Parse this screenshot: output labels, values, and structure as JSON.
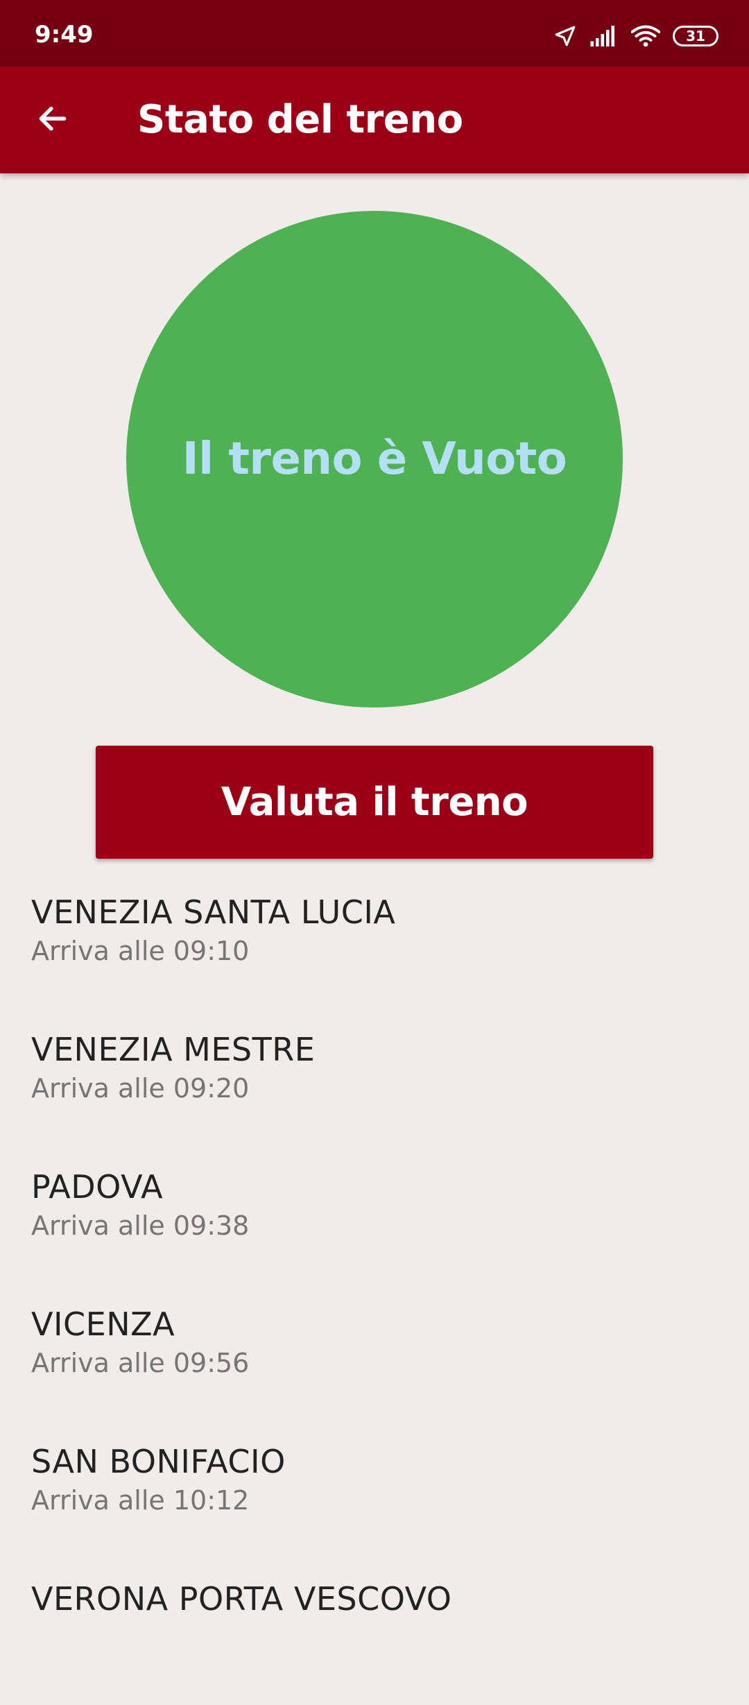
{
  "status_bar": {
    "time": "9:49",
    "battery": "31",
    "icons": [
      "location-arrow-icon",
      "signal-icon",
      "wifi-icon",
      "battery-icon"
    ]
  },
  "app_bar": {
    "title": "Stato del treno",
    "back_icon": "arrow-back-icon"
  },
  "status_indicator": {
    "text": "Il treno è Vuoto",
    "color": "#4fb153",
    "text_color": "#b3e0f2"
  },
  "rate_button": {
    "label": "Valuta il treno"
  },
  "colors": {
    "primary": "#9c0017",
    "status_bar": "#740011",
    "background": "#efecea"
  },
  "stops": [
    {
      "name": "VENEZIA SANTA LUCIA",
      "arrival": "Arriva alle 09:10"
    },
    {
      "name": "VENEZIA MESTRE",
      "arrival": "Arriva alle 09:20"
    },
    {
      "name": "PADOVA",
      "arrival": "Arriva alle 09:38"
    },
    {
      "name": "VICENZA",
      "arrival": "Arriva alle 09:56"
    },
    {
      "name": "SAN BONIFACIO",
      "arrival": "Arriva alle 10:12"
    },
    {
      "name": "VERONA PORTA VESCOVO",
      "arrival": ""
    }
  ]
}
